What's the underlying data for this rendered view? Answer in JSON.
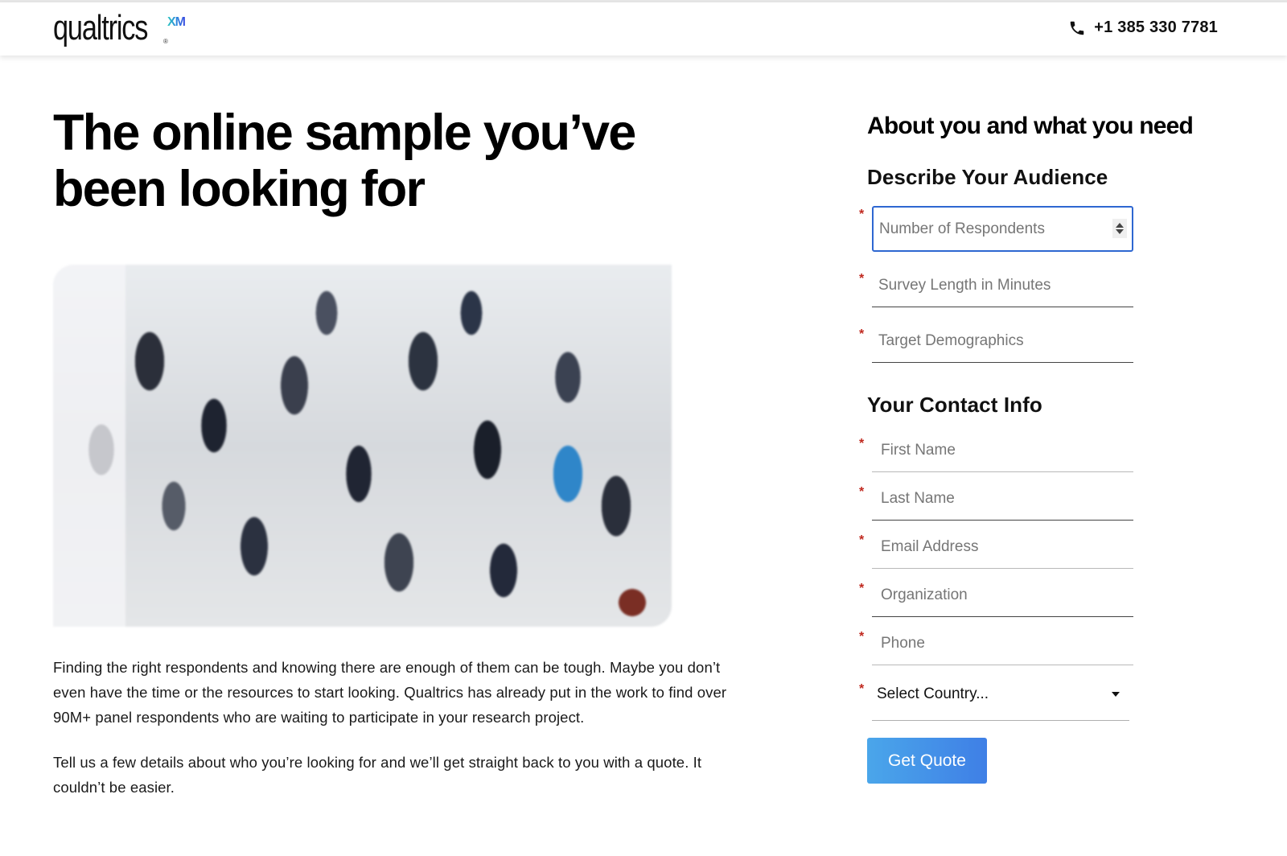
{
  "header": {
    "logo_text": "qualtrics",
    "logo_registered": "®",
    "logo_suffix": "XM",
    "phone": "+1 385 330 7781",
    "phone_icon": "phone-icon"
  },
  "hero": {
    "title": "The online sample you’ve been looking for",
    "image_alt": "Crowd of people walking in a bright convention hall",
    "paragraphs": [
      "Finding the right respondents and knowing there are enough of them can be tough. Maybe you don’t even have the time or the resources to start looking. Qualtrics has already put in the work to find over 90M+ panel respondents who are waiting to participate in your research project.",
      "Tell us a few details about who you’re looking for and we’ll get straight back to you with a quote. It couldn’t be easier."
    ]
  },
  "form": {
    "title": "About you and what you need",
    "required_marker": "*",
    "audience_section": "Describe Your Audience",
    "audience_fields": [
      {
        "placeholder": "Number of Respondents",
        "value": ""
      },
      {
        "placeholder": "Survey Length in Minutes",
        "value": ""
      },
      {
        "placeholder": "Target Demographics",
        "value": ""
      }
    ],
    "contact_section": "Your Contact Info",
    "contact_fields": [
      {
        "placeholder": "First Name",
        "value": ""
      },
      {
        "placeholder": "Last Name",
        "value": ""
      },
      {
        "placeholder": "Email Address",
        "value": ""
      },
      {
        "placeholder": "Organization",
        "value": ""
      },
      {
        "placeholder": "Phone",
        "value": ""
      }
    ],
    "country_select": "Select Country...",
    "submit_label": "Get Quote"
  },
  "colors": {
    "accent_blue": "#2e67d1",
    "button_gradient_start": "#4aa6ea",
    "button_gradient_end": "#3f7fe6",
    "required_red": "#c0281e"
  }
}
